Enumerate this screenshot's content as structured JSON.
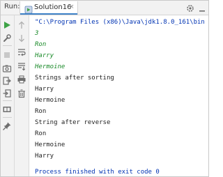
{
  "header": {
    "run_label": "Run:",
    "tab_title": "Solution16",
    "tab_close": "×"
  },
  "colors": {
    "command": "#0033b3",
    "user_input": "#1a8a29",
    "output": "#1f1f1f",
    "tab_accent": "#4083c9",
    "run_green": "#3ea346",
    "stop_red": "#d9534f"
  },
  "icons": {
    "left_toolbar": [
      "run-icon",
      "wrench-icon",
      "stop-icon",
      "camera-icon",
      "exit-icon",
      "login-icon",
      "layout-icon",
      "pin-icon"
    ],
    "right_toolbar": [
      "arrow-up-icon",
      "arrow-down-icon",
      "soft-wrap-icon",
      "scroll-to-end-icon",
      "print-icon",
      "delete-icon"
    ],
    "header": [
      "gear-icon",
      "minimize-icon"
    ]
  },
  "console": {
    "lines": [
      {
        "type": "cmd",
        "text": "\"C:\\Program Files (x86)\\Java\\jdk1.8.0_161\\bin"
      },
      {
        "type": "in",
        "text": "3"
      },
      {
        "type": "in",
        "text": "Ron"
      },
      {
        "type": "in",
        "text": "Harry"
      },
      {
        "type": "in",
        "text": "Hermoine"
      },
      {
        "type": "out",
        "text": "Strings after sorting"
      },
      {
        "type": "out",
        "text": "Harry"
      },
      {
        "type": "out",
        "text": "Hermoine"
      },
      {
        "type": "out",
        "text": "Ron"
      },
      {
        "type": "out",
        "text": "String after reverse"
      },
      {
        "type": "out",
        "text": "Ron"
      },
      {
        "type": "out",
        "text": "Hermoine"
      },
      {
        "type": "out",
        "text": "Harry"
      },
      {
        "type": "blank",
        "text": ""
      },
      {
        "type": "exit",
        "text": "Process finished with exit code 0"
      }
    ]
  }
}
